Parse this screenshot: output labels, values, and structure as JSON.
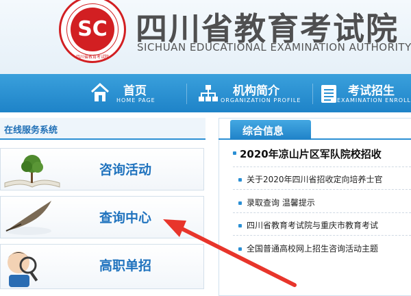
{
  "header": {
    "title": "四川省教育考试院",
    "subtitle": "SICHUAN EDUCATIONAL EXAMINATION AUTHORITY",
    "logo": {
      "mark": "SC",
      "text": "四川省教育考试院"
    }
  },
  "nav": {
    "items": [
      {
        "zh": "首页",
        "en": "HOME PAGE",
        "icon": "home-icon"
      },
      {
        "zh": "机构简介",
        "en": "ORGANIZATION PROFILE",
        "icon": "org-chart-icon"
      },
      {
        "zh": "考试招生",
        "en": "EXAMINATION ENROLL",
        "icon": "list-icon"
      }
    ]
  },
  "sidebar": {
    "title": "在线服务系统",
    "items": [
      {
        "label": "咨询活动",
        "icon": "tree-book-icon"
      },
      {
        "label": "查询中心",
        "icon": "quill-pen-icon"
      },
      {
        "label": "高职单招",
        "icon": "magnifier-kid-icon"
      }
    ]
  },
  "content": {
    "tab": "综合信息",
    "headline": "2020年凉山片区军队院校招收",
    "news": [
      "关于2020年四川省招收定向培养士官",
      "录取查询 温馨提示",
      "四川省教育考试院与重庆市教育考试",
      "全国普通高校网上招生咨询活动主题"
    ]
  },
  "colors": {
    "accent": "#2b8fd4",
    "brand_red": "#d21f22",
    "annotation_arrow": "#e8352b"
  }
}
